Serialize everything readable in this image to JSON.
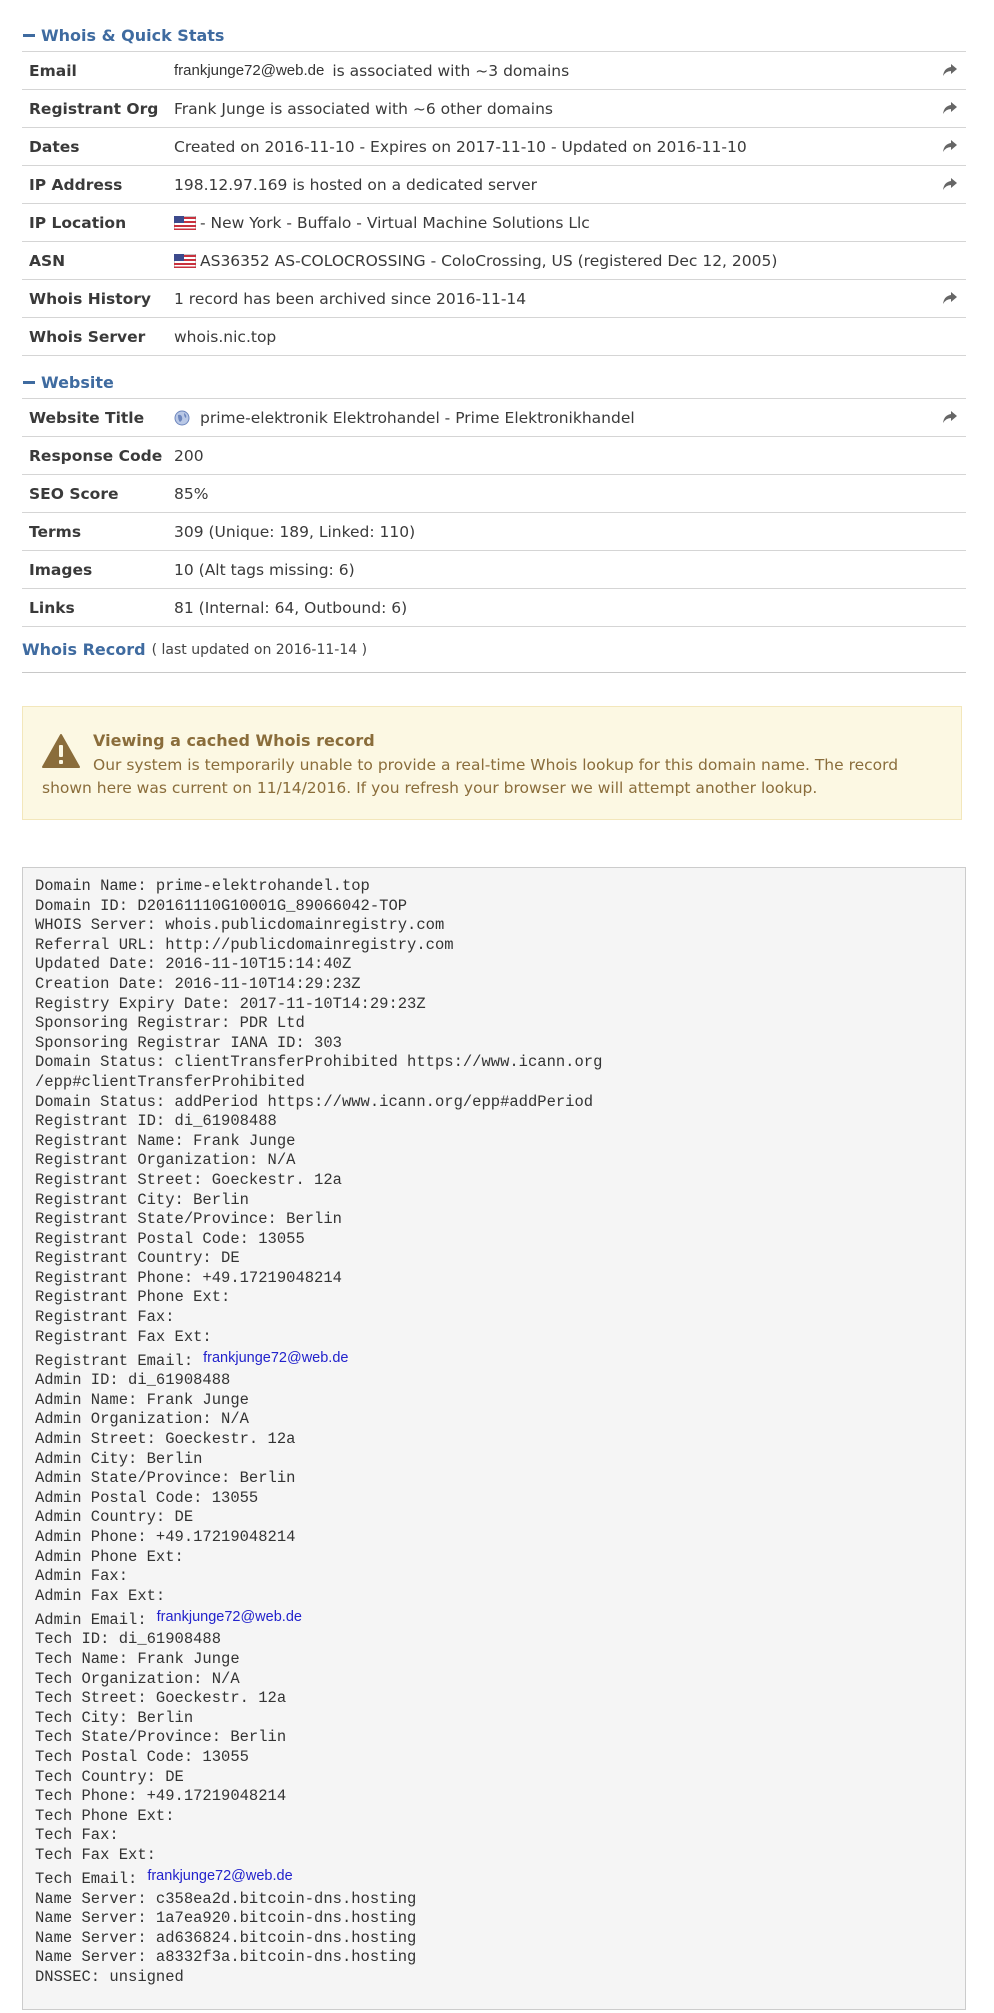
{
  "whois_section": {
    "title": "Whois & Quick Stats",
    "rows": [
      {
        "label": "Email",
        "email": "frankjunge72@web.de",
        "text": "is associated with ~3 domains",
        "share": true
      },
      {
        "label": "Registrant Org",
        "text": "Frank Junge is associated with ~6 other domains",
        "share": true
      },
      {
        "label": "Dates",
        "text": "Created on 2016-11-10 - Expires on 2017-11-10 - Updated on 2016-11-10",
        "share": true
      },
      {
        "label": "IP Address",
        "text": "198.12.97.169 is hosted on a dedicated server",
        "share": true
      },
      {
        "label": "IP Location",
        "flag": "us-flag-icon",
        "text": "- New York - Buffalo - Virtual Machine Solutions Llc",
        "share": false
      },
      {
        "label": "ASN",
        "flag": "us-flag-icon",
        "text": "AS36352 AS-COLOCROSSING - ColoCrossing, US (registered Dec 12, 2005)",
        "share": false
      },
      {
        "label": "Whois History",
        "text": "1 record has been archived since 2016-11-14",
        "share": true
      },
      {
        "label": "Whois Server",
        "text": "whois.nic.top",
        "share": false
      }
    ]
  },
  "website_section": {
    "title": "Website",
    "rows": [
      {
        "label": "Website Title",
        "globe": "globe-icon",
        "text": "prime-elektronik Elektrohandel - Prime Elektronikhandel",
        "share": true
      },
      {
        "label": "Response Code",
        "text": "200",
        "share": false
      },
      {
        "label": "SEO Score",
        "text": "85%",
        "share": false
      },
      {
        "label": "Terms",
        "text": "309 (Unique: 189, Linked: 110)",
        "share": false
      },
      {
        "label": "Images",
        "text": "10 (Alt tags missing: 6)",
        "share": false
      },
      {
        "label": "Links",
        "text": "81   (Internal: 64, Outbound: 6)",
        "share": false
      }
    ]
  },
  "whois_record": {
    "title": "Whois Record",
    "subtitle": "( last updated on 2016-11-14 )"
  },
  "warning": {
    "icon": "warning-icon",
    "title": "Viewing a cached Whois record",
    "body": "Our system is temporarily unable to provide a real-time Whois lookup for this domain name. The record shown here was current on 11/14/2016. If you refresh your browser we will attempt another lookup."
  },
  "record_lines": [
    {
      "t": "Domain Name: prime-elektrohandel.top"
    },
    {
      "t": "Domain ID: D20161110G10001G_89066042-TOP"
    },
    {
      "t": "WHOIS Server: whois.publicdomainregistry.com"
    },
    {
      "t": "Referral URL: http://publicdomainregistry.com"
    },
    {
      "t": "Updated Date: 2016-11-10T15:14:40Z"
    },
    {
      "t": "Creation Date: 2016-11-10T14:29:23Z"
    },
    {
      "t": "Registry Expiry Date: 2017-11-10T14:29:23Z"
    },
    {
      "t": "Sponsoring Registrar: PDR Ltd"
    },
    {
      "t": "Sponsoring Registrar IANA ID: 303"
    },
    {
      "t": "Domain Status: clientTransferProhibited https://www.icann.org"
    },
    {
      "t": "/epp#clientTransferProhibited"
    },
    {
      "t": "Domain Status: addPeriod https://www.icann.org/epp#addPeriod"
    },
    {
      "t": "Registrant ID: di_61908488"
    },
    {
      "t": "Registrant Name: Frank Junge"
    },
    {
      "t": "Registrant Organization: N/A"
    },
    {
      "t": "Registrant Street: Goeckestr. 12a"
    },
    {
      "t": "Registrant City: Berlin"
    },
    {
      "t": "Registrant State/Province: Berlin"
    },
    {
      "t": "Registrant Postal Code: 13055"
    },
    {
      "t": "Registrant Country: DE"
    },
    {
      "t": "Registrant Phone: +49.17219048214"
    },
    {
      "t": "Registrant Phone Ext:"
    },
    {
      "t": "Registrant Fax:"
    },
    {
      "t": "Registrant Fax Ext:"
    },
    {
      "t": "Registrant Email:",
      "email": "frankjunge72@web.de"
    },
    {
      "t": "Admin ID: di_61908488"
    },
    {
      "t": "Admin Name: Frank Junge"
    },
    {
      "t": "Admin Organization: N/A"
    },
    {
      "t": "Admin Street: Goeckestr. 12a"
    },
    {
      "t": "Admin City: Berlin"
    },
    {
      "t": "Admin State/Province: Berlin"
    },
    {
      "t": "Admin Postal Code: 13055"
    },
    {
      "t": "Admin Country: DE"
    },
    {
      "t": "Admin Phone: +49.17219048214"
    },
    {
      "t": "Admin Phone Ext:"
    },
    {
      "t": "Admin Fax:"
    },
    {
      "t": "Admin Fax Ext:"
    },
    {
      "t": "Admin Email:",
      "email": "frankjunge72@web.de"
    },
    {
      "t": "Tech ID: di_61908488"
    },
    {
      "t": "Tech Name: Frank Junge"
    },
    {
      "t": "Tech Organization: N/A"
    },
    {
      "t": "Tech Street: Goeckestr. 12a"
    },
    {
      "t": "Tech City: Berlin"
    },
    {
      "t": "Tech State/Province: Berlin"
    },
    {
      "t": "Tech Postal Code: 13055"
    },
    {
      "t": "Tech Country: DE"
    },
    {
      "t": "Tech Phone: +49.17219048214"
    },
    {
      "t": "Tech Phone Ext:"
    },
    {
      "t": "Tech Fax:"
    },
    {
      "t": "Tech Fax Ext:"
    },
    {
      "t": "Tech Email:",
      "email": "frankjunge72@web.de"
    },
    {
      "t": "Name Server: c358ea2d.bitcoin-dns.hosting"
    },
    {
      "t": "Name Server: 1a7ea920.bitcoin-dns.hosting"
    },
    {
      "t": "Name Server: ad636824.bitcoin-dns.hosting"
    },
    {
      "t": "Name Server: a8332f3a.bitcoin-dns.hosting"
    },
    {
      "t": "DNSSEC: unsigned"
    }
  ],
  "colors": {
    "heading": "#3f6ba0",
    "warning_bg": "#fcf8e3",
    "warning_text": "#8a6d3b",
    "email_link": "#2222cc"
  }
}
